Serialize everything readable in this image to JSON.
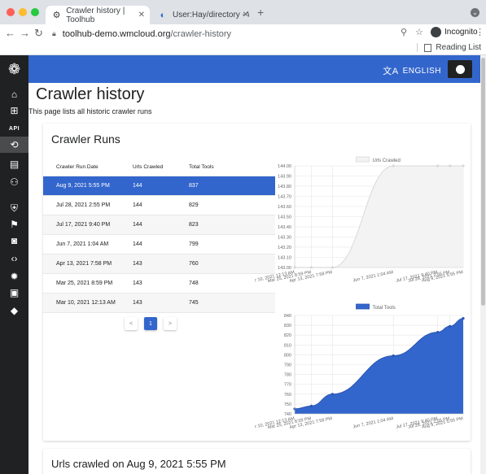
{
  "browser": {
    "tabs": [
      {
        "title": "Crawler history | Toolhub",
        "active": true
      },
      {
        "title": "User:Hay/directory - Wikitech",
        "active": false
      }
    ],
    "url_host": "toolhub-demo.wmcloud.org",
    "url_path": "/crawler-history",
    "incognito_label": "Incognito",
    "reading_list_label": "Reading List"
  },
  "appbar": {
    "language_label": "ENGLISH"
  },
  "sidebar": {
    "items": [
      {
        "icon": "home-icon"
      },
      {
        "icon": "add-tool-icon"
      },
      {
        "icon": "api-icon",
        "label": "API"
      },
      {
        "icon": "history-icon",
        "active": true
      },
      {
        "icon": "tool-list-icon"
      },
      {
        "icon": "members-icon"
      },
      {
        "icon": "shield-icon"
      },
      {
        "icon": "flag-icon"
      },
      {
        "icon": "audit-icon"
      },
      {
        "icon": "code-icon"
      },
      {
        "icon": "bug-icon"
      },
      {
        "icon": "document-icon"
      },
      {
        "icon": "diff-icon"
      }
    ]
  },
  "page": {
    "title": "Crawler history",
    "subtitle": "This page lists all historic crawler runs"
  },
  "crawler_runs": {
    "title": "Crawler Runs",
    "columns": [
      "Crawler Run Date",
      "Urls Crawled",
      "Total Tools"
    ],
    "rows": [
      {
        "date": "Aug 9, 2021 5:55 PM",
        "urls": "144",
        "tools": "837",
        "selected": true
      },
      {
        "date": "Jul 28, 2021 2:55 PM",
        "urls": "144",
        "tools": "829"
      },
      {
        "date": "Jul 17, 2021 9:40 PM",
        "urls": "144",
        "tools": "823"
      },
      {
        "date": "Jun 7, 2021 1:04 AM",
        "urls": "144",
        "tools": "799"
      },
      {
        "date": "Apr 13, 2021 7:58 PM",
        "urls": "143",
        "tools": "760"
      },
      {
        "date": "Mar 25, 2021 8:59 PM",
        "urls": "143",
        "tools": "748"
      },
      {
        "date": "Mar 10, 2021 12:13 AM",
        "urls": "143",
        "tools": "745"
      }
    ],
    "pagination": {
      "prev": "<",
      "current": "1",
      "next": ">"
    }
  },
  "urls_crawled_section": {
    "title": "Urls crawled on Aug 9, 2021 5:55 PM"
  },
  "chart_data": [
    {
      "type": "area",
      "legend": "Urls Crawled",
      "legend_placement": "top-center",
      "categories": [
        "Mar 10, 2021 12:13 AM",
        "Mar 25, 2021 8:59 PM",
        "Apr 13, 2021 7:58 PM",
        "Jun 7, 2021 1:04 AM",
        "Jul 17, 2021 9:40 PM",
        "Jul 28, 2021 2:55 PM",
        "Aug 9, 2021 5:55 PM"
      ],
      "x_dates": [
        "2021-03-10",
        "2021-03-25",
        "2021-04-13",
        "2021-06-07",
        "2021-07-17",
        "2021-07-28",
        "2021-08-09"
      ],
      "values": [
        143,
        143,
        143,
        144,
        144,
        144,
        144
      ],
      "yticks": [
        "143.00",
        "143.10",
        "143.20",
        "143.30",
        "143.40",
        "143.50",
        "143.60",
        "143.70",
        "143.80",
        "143.90",
        "144.00"
      ],
      "ylim": [
        143,
        144
      ],
      "fill": "#f3f3f4",
      "stroke": "#d9d9dc",
      "grid": true
    },
    {
      "type": "area",
      "legend": "Total Tools",
      "legend_placement": "top-center",
      "categories": [
        "Mar 10, 2021 12:13 AM",
        "Mar 25, 2021 8:59 PM",
        "Apr 13, 2021 7:58 PM",
        "Jun 7, 2021 1:04 AM",
        "Jul 17, 2021 9:40 PM",
        "Jul 28, 2021 2:55 PM",
        "Aug 9, 2021 5:55 PM"
      ],
      "x_dates": [
        "2021-03-10",
        "2021-03-25",
        "2021-04-13",
        "2021-06-07",
        "2021-07-17",
        "2021-07-28",
        "2021-08-09"
      ],
      "values": [
        745,
        748,
        760,
        799,
        823,
        829,
        837
      ],
      "yticks": [
        "740",
        "750",
        "760",
        "770",
        "780",
        "790",
        "800",
        "810",
        "820",
        "830",
        "840"
      ],
      "ylim": [
        740,
        840
      ],
      "fill": "#3366cc",
      "stroke": "#2a55b0",
      "grid": true
    }
  ]
}
